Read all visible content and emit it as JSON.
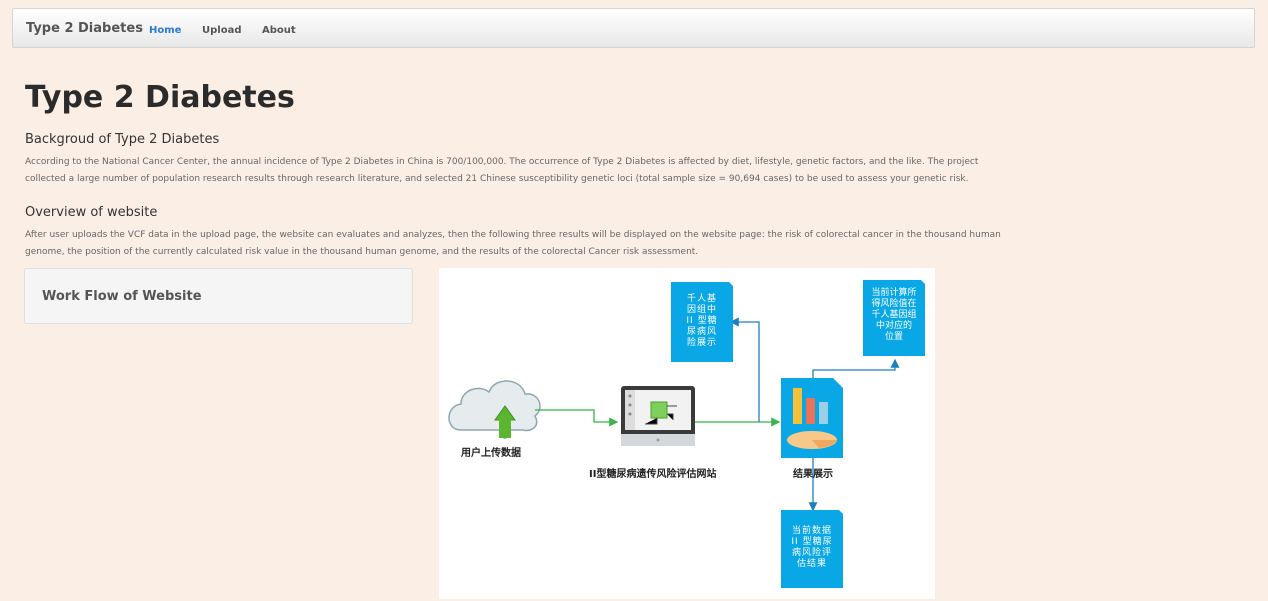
{
  "navbar": {
    "brand": "Type 2 Diabetes",
    "links": [
      "Home",
      "Upload",
      "About"
    ],
    "active": "Home"
  },
  "page": {
    "title": "Type 2 Diabetes",
    "background_heading": "Backgroud of Type 2 Diabetes",
    "background_lines": [
      "According to the National Cancer Center, the annual incidence of Type 2 Diabetes in China is 700/100,000. The occurrence of Type 2 Diabetes is affected by diet, lifestyle, genetic factors, and the like. The project",
      "collected a large number of population research results through research literature, and selected 21 Chinese susceptibility genetic loci (total sample size = 90,694 cases) to be used to assess your genetic risk."
    ],
    "overview_heading": "Overview of website",
    "overview_lines": [
      "After user uploads the VCF data in the upload page, the website can evaluates and analyzes, then the following three results will be displayed on the website page: the risk of colorectal cancer in the thousand human",
      "genome, the position of the currently calculated risk value in the thousand human genome, and the results of the colorectal Cancer risk assessment."
    ],
    "workflow_title": "Work Flow of Website"
  },
  "diagram": {
    "upload_label": "用户上传数据",
    "website_label": "II型糖尿病遗传风险评估网站",
    "result_label": "结果展示",
    "note_top_left": [
      "千人基",
      "因组中",
      "II 型糖",
      "尿病风",
      "险展示"
    ],
    "note_top_right": [
      "当前计算所",
      "得风险值在",
      "千人基因组",
      "中对应的",
      "位置"
    ],
    "note_bottom": [
      "当前数据",
      "II 型糖尿",
      "病风险评",
      "估结果"
    ],
    "colors": {
      "note_blue": "#0aa7e6",
      "arrow_green": "#39b54a",
      "arrow_blue": "#1e7fc0",
      "cloud_fill": "#e6ecee",
      "upload_arrow": "#5cb531"
    }
  }
}
